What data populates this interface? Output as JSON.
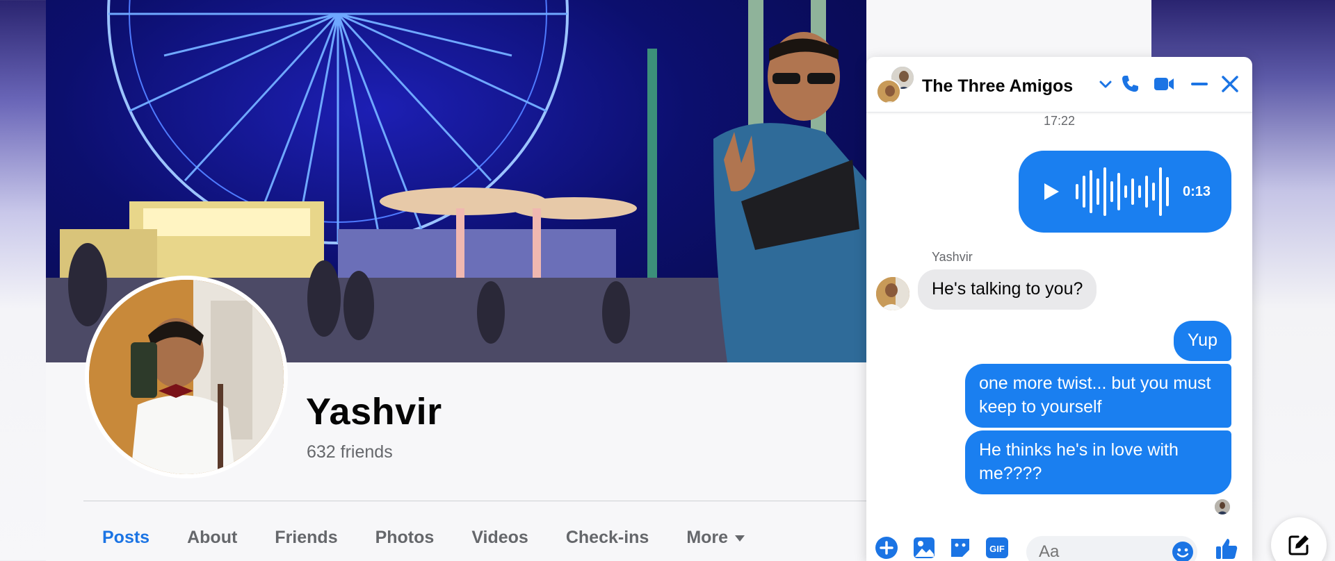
{
  "profile": {
    "name": "Yashvir",
    "friends": "632 friends",
    "tabs": [
      {
        "label": "Posts",
        "active": true
      },
      {
        "label": "About",
        "active": false
      },
      {
        "label": "Friends",
        "active": false
      },
      {
        "label": "Photos",
        "active": false
      },
      {
        "label": "Videos",
        "active": false
      },
      {
        "label": "Check-ins",
        "active": false
      },
      {
        "label": "More",
        "active": false
      }
    ]
  },
  "chat": {
    "title": "The Three Amigos",
    "time": "17:22",
    "voice_message": {
      "duration": "0:13"
    },
    "messages": [
      {
        "sender": "Yashvir",
        "text": "He's talking to you?",
        "direction": "incoming"
      },
      {
        "text": "Yup",
        "direction": "outgoing"
      },
      {
        "text": "one more twist... but you must keep to yourself",
        "direction": "outgoing"
      },
      {
        "text": "He thinks he's in love with me????",
        "direction": "outgoing"
      }
    ],
    "composer": {
      "placeholder": "Aa"
    },
    "header_icons": [
      "phone-icon",
      "video-camera-icon",
      "minimize-icon",
      "close-icon"
    ],
    "composer_icons": [
      "plus-icon",
      "photo-icon",
      "sticker-icon",
      "gif-icon",
      "emoji-icon",
      "thumbs-up-icon"
    ]
  },
  "colors": {
    "accent": "#1b74e4",
    "bubble_out": "#1a7ff0",
    "bubble_in": "#e9e9eb"
  }
}
